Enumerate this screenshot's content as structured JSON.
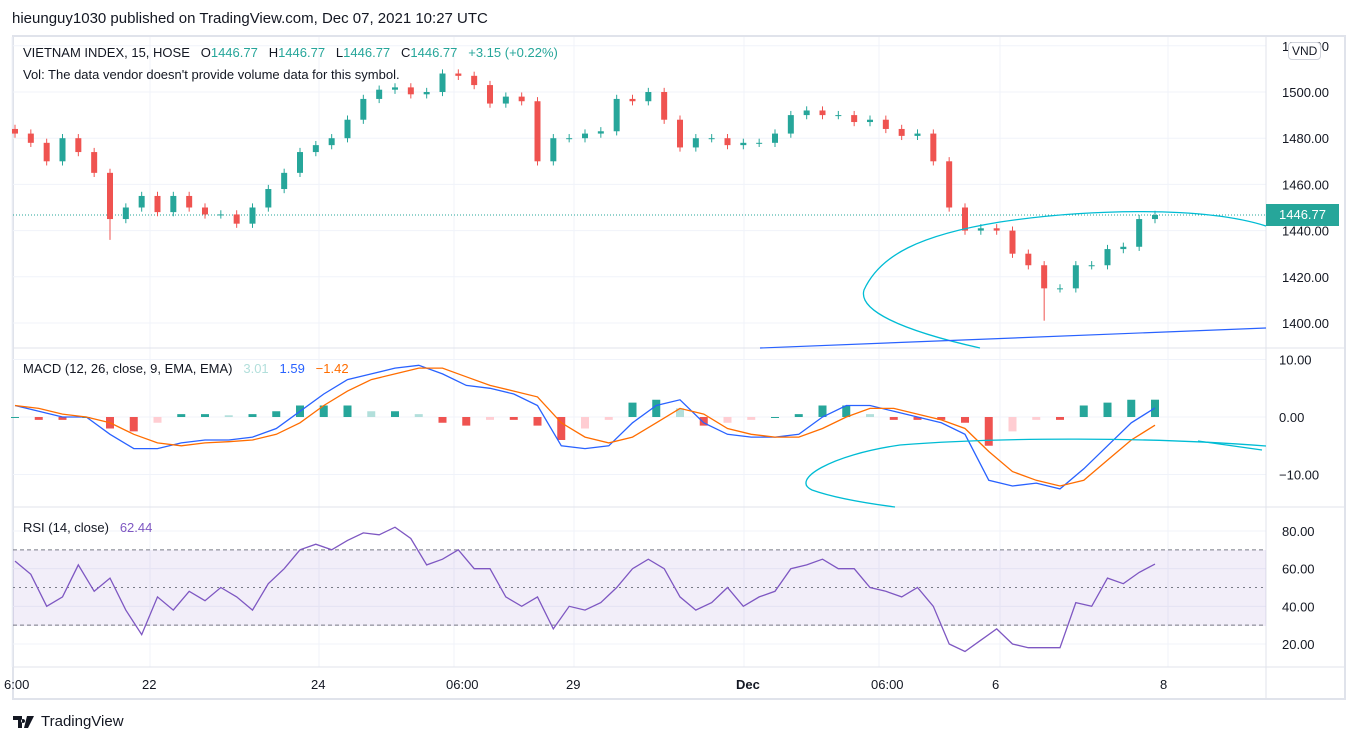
{
  "header": {
    "published": "hieunguy1030 published on TradingView.com, Dec 07, 2021 10:27 UTC"
  },
  "legend": {
    "symbol": "VIETNAM INDEX, 15, HOSE",
    "o_label": "O",
    "o": "1446.77",
    "h_label": "H",
    "h": "1446.77",
    "l_label": "L",
    "l": "1446.77",
    "c_label": "C",
    "c": "1446.77",
    "change": "+3.15 (+0.22%)",
    "vol": "Vol: The data vendor doesn't provide volume data for this symbol."
  },
  "macd_legend": {
    "title": "MACD (12, 26, close, 9, EMA, EMA)",
    "hist": "3.01",
    "macd": "1.59",
    "signal": "−1.42"
  },
  "rsi_legend": {
    "title": "RSI (14, close)",
    "value": "62.44"
  },
  "currency": "VND",
  "last_price": "1446.77",
  "footer": {
    "brand": "TradingView"
  },
  "colors": {
    "up": "#26a69a",
    "down": "#ef5350",
    "macd": "#2962ff",
    "signal": "#ff6d00",
    "rsi": "#7e57c2",
    "drawing": "#00bcd4"
  },
  "chart_data": [
    {
      "type": "candlestick",
      "title": "VIETNAM INDEX, 15, HOSE",
      "ylim": [
        1390,
        1520
      ],
      "yticks": [
        "1520.00",
        "1500.00",
        "1480.00",
        "1460.00",
        "1440.00",
        "1420.00",
        "1400.00"
      ],
      "closes": [
        1482,
        1478,
        1470,
        1480,
        1474,
        1465,
        1445,
        1450,
        1455,
        1448,
        1455,
        1450,
        1447,
        1447,
        1443,
        1450,
        1458,
        1465,
        1474,
        1477,
        1480,
        1488,
        1497,
        1501,
        1502,
        1499,
        1500,
        1508,
        1507,
        1503,
        1495,
        1498,
        1496,
        1470,
        1480,
        1480,
        1482,
        1483,
        1497,
        1496,
        1500,
        1488,
        1476,
        1480,
        1480,
        1477,
        1478,
        1478,
        1482,
        1490,
        1492,
        1490,
        1490,
        1487,
        1488,
        1484,
        1481,
        1482,
        1470,
        1450,
        1440,
        1441,
        1440,
        1430,
        1425,
        1415,
        1415,
        1425,
        1425,
        1432,
        1433,
        1445,
        1446.77
      ],
      "wick_lows": {
        "6": 1436,
        "65": 1401
      }
    },
    {
      "type": "line",
      "title": "MACD (12, 26, close, 9, EMA, EMA)",
      "ylim": [
        -15,
        12
      ],
      "yticks": [
        "10.00",
        "0.00",
        "−10.00"
      ],
      "series": [
        {
          "name": "MACD",
          "values": [
            2,
            1,
            0,
            0,
            -3,
            -5.5,
            -5.5,
            -4.5,
            -4,
            -4,
            -3.5,
            -2,
            1,
            4,
            6.5,
            7.5,
            8.5,
            9,
            7.5,
            5.5,
            5,
            4,
            2,
            -5,
            -5.5,
            -5,
            -1,
            2,
            3,
            -1,
            -3,
            -3.5,
            -3.5,
            -3,
            0,
            2,
            2,
            1,
            0,
            -1,
            -3,
            -11,
            -12,
            -11.5,
            -12.5,
            -9,
            -5,
            -1,
            1.59
          ]
        },
        {
          "name": "Signal",
          "values": [
            2,
            1.5,
            0.5,
            0,
            -1,
            -3,
            -4.5,
            -5,
            -4.5,
            -4.3,
            -4,
            -3,
            -1,
            2,
            4.5,
            6.5,
            7.5,
            8.5,
            8.5,
            7,
            5.5,
            4.5,
            3.5,
            -1,
            -3.5,
            -4.5,
            -3.5,
            -1,
            1.5,
            0.5,
            -2,
            -3,
            -3.5,
            -3.5,
            -2,
            0,
            1.5,
            1.5,
            0.5,
            -0.5,
            -2,
            -6,
            -9.5,
            -11,
            -12,
            -11,
            -7.5,
            -4,
            -1.42
          ]
        }
      ]
    },
    {
      "type": "line",
      "title": "RSI (14, close)",
      "ylim": [
        12,
        88
      ],
      "yticks": [
        "80.00",
        "60.00",
        "40.00",
        "20.00"
      ],
      "bands": [
        30,
        50,
        70
      ],
      "values": [
        64,
        57,
        40,
        45,
        62,
        48,
        55,
        38,
        25,
        45,
        38,
        48,
        43,
        50,
        45,
        38,
        52,
        60,
        70,
        73,
        70,
        75,
        79,
        78,
        82,
        76,
        62,
        65,
        70,
        60,
        60,
        45,
        40,
        45,
        28,
        40,
        38,
        42,
        50,
        60,
        65,
        60,
        45,
        38,
        42,
        50,
        40,
        45,
        48,
        60,
        62,
        65,
        60,
        60,
        50,
        48,
        45,
        50,
        40,
        20,
        16,
        22,
        28,
        20,
        18,
        18,
        18,
        42,
        40,
        55,
        52,
        58,
        62.44
      ]
    },
    {
      "type": "time-axis",
      "labels": [
        "6:00",
        "22",
        "24",
        "06:00",
        "29",
        "Dec",
        "06:00",
        "6",
        "8"
      ]
    }
  ]
}
